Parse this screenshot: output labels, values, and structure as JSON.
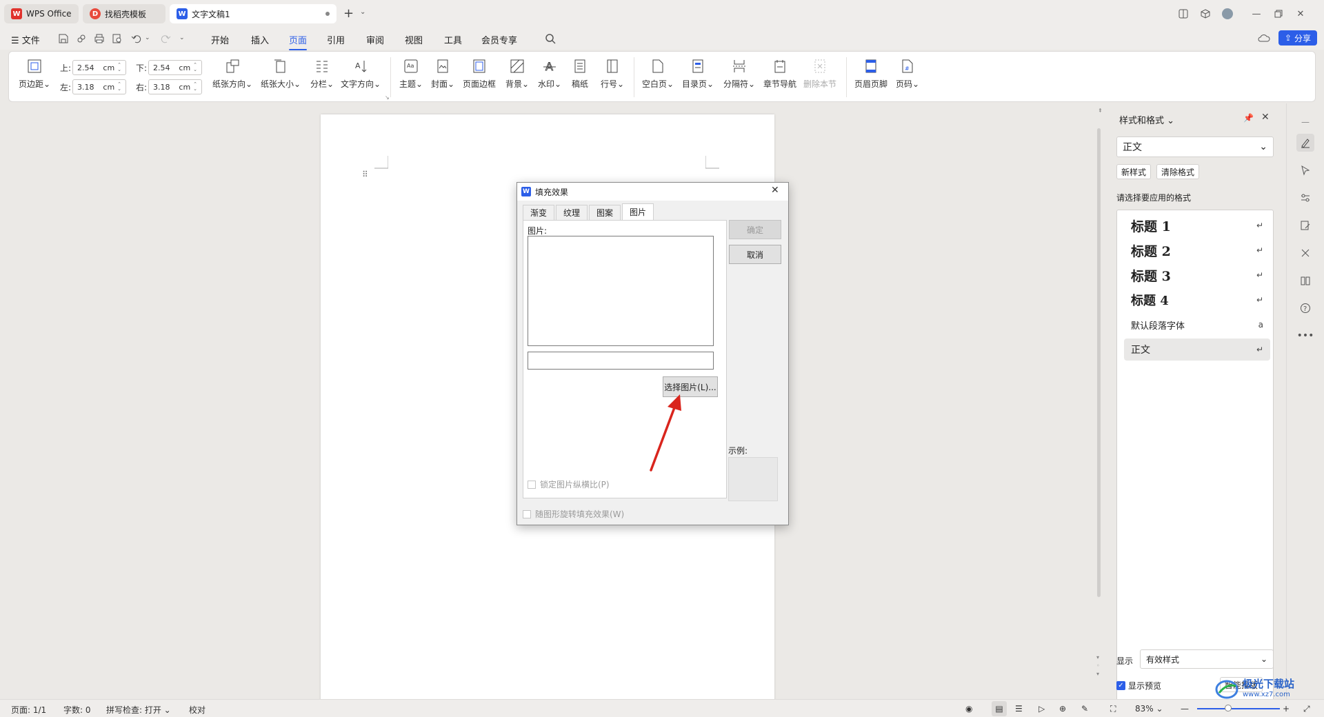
{
  "tabs": [
    {
      "label": "WPS Office",
      "icon": "wps-logo-icon"
    },
    {
      "label": "找稻壳模板",
      "icon": "docer-icon"
    },
    {
      "label": "文字文稿1",
      "icon": "writer-icon"
    }
  ],
  "menubar": {
    "file": "文件",
    "items": [
      "开始",
      "插入",
      "页面",
      "引用",
      "审阅",
      "视图",
      "工具",
      "会员专享"
    ],
    "selected": "页面",
    "share": "分享"
  },
  "ribbon": {
    "page_margin": "页边距",
    "margins": {
      "top_label": "上:",
      "top": "2.54",
      "bottom_label": "下:",
      "bottom": "2.54",
      "left_label": "左:",
      "left": "3.18",
      "right_label": "右:",
      "right": "3.18",
      "unit": "cm"
    },
    "buttons": [
      "纸张方向",
      "纸张大小",
      "分栏",
      "文字方向",
      "主题",
      "封面",
      "页面边框",
      "背景",
      "水印",
      "稿纸",
      "行号",
      "空白页",
      "目录页",
      "分隔符",
      "章节导航",
      "删除本节",
      "页眉页脚",
      "页码"
    ]
  },
  "dialog": {
    "title": "填充效果",
    "tabs": [
      "渐变",
      "纹理",
      "图案",
      "图片"
    ],
    "selected_tab": "图片",
    "picture_label": "图片:",
    "select_button": "选择图片(L)...",
    "ok": "确定",
    "cancel": "取消",
    "sample_label": "示例:",
    "lock_aspect": "锁定图片纵横比(P)",
    "rotate_with_shape": "随图形旋转填充效果(W)"
  },
  "panel": {
    "title": "样式和格式",
    "current_style": "正文",
    "new_style": "新样式",
    "clear_format": "清除格式",
    "prompt": "请选择要应用的格式",
    "styles": [
      {
        "name": "标题  1",
        "mark": "↵"
      },
      {
        "name": "标题  2",
        "mark": "↵"
      },
      {
        "name": "标题  3",
        "mark": "↵"
      },
      {
        "name": "标题  4",
        "mark": "↵"
      },
      {
        "name": "默认段落字体",
        "mark": "a"
      },
      {
        "name": "正文",
        "mark": "↵"
      }
    ],
    "show_label": "显示",
    "show_value": "有效样式",
    "preview": "显示预览",
    "smart_layout": "智能排版"
  },
  "status": {
    "page": "页面: 1/1",
    "words": "字数: 0",
    "spell": "拼写检查: 打开",
    "proof": "校对",
    "zoom": "83%"
  },
  "watermark": "极光下载站",
  "watermark_url": "www.xz7.com",
  "colors": {
    "accent": "#2c5ee8",
    "wps_red": "#e0322c",
    "arrow": "#d9251d"
  }
}
